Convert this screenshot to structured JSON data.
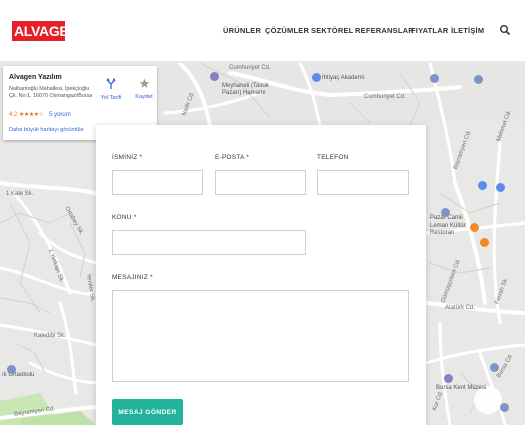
{
  "header": {
    "logo_text": "ALVAGEN",
    "nav": [
      "ÜRÜNLER",
      "ÇÖZÜMLER",
      "SEKTÖREL",
      "REFERANSLAR",
      "FIYATLAR",
      "İLETİŞİM"
    ],
    "search_icon": "search-icon"
  },
  "place_card": {
    "title": "Alvagen Yazılım",
    "address": "Nalbantoğlu Mahallesi, İpekçioğlu Çk. No:1, 16070 Osmangazi/Bursa",
    "rating": "4.2",
    "stars": "★★★★☆",
    "reviews": "5 yorum",
    "larger_map": "Daha büyük haritayı görüntüle",
    "directions_label": "Yol Tarifi",
    "save_label": "Kaydet"
  },
  "map_labels": {
    "cumhuriyet1": "Cumhuriyet Cd.",
    "cumhuriyet2": "Cumhuriyet Cd.",
    "meyhane": "Meyhaneli (Tavuk Pazarı) Hamamı",
    "ihtiyac": "İhtiyaç Akademi",
    "pazar_cami": "Pazar Camii",
    "leman": "Leman Kültür Restoran",
    "bursa_kent": "Bursa Kent Müzesi",
    "ataturk": "Atatürk Cd.",
    "ortaokul": "ılı Ortaokulu",
    "bayramyeri": "Bayramyeri Cd.",
    "kaledibi": "Kaledibi Sk.",
    "yerkap": "1 Yerkapı Sk.",
    "ortabey": "Ortabey Sk.",
    "yeniler": "Yeniler Sk.",
    "kale": "1 Kale Sk.",
    "nadir": "Nadir Cd.",
    "bayramyeri_cd": "Bayramyeri Cd.",
    "mehmet_cd": "Mehmet Cd.",
    "gumusceken": "Gümüşçeken Cd.",
    "ferrah": "Ferrah Sk.",
    "bursa_cd": "Bursa Cd.",
    "kur_cd": "Kur Cd."
  },
  "form": {
    "name_label": "İSMİNİZ *",
    "email_label": "E-POSTA *",
    "phone_label": "TELEFON",
    "subject_label": "KONU *",
    "message_label": "MESAJINIZ *",
    "name_value": "",
    "email_value": "",
    "phone_value": "",
    "subject_value": "",
    "message_value": "",
    "submit_label": "MESAJ GÖNDER"
  },
  "colors": {
    "brand_red": "#e4212b",
    "submit_teal": "#22b39a",
    "map_bg": "#e8e8e6",
    "map_park": "#c9e6b3"
  }
}
